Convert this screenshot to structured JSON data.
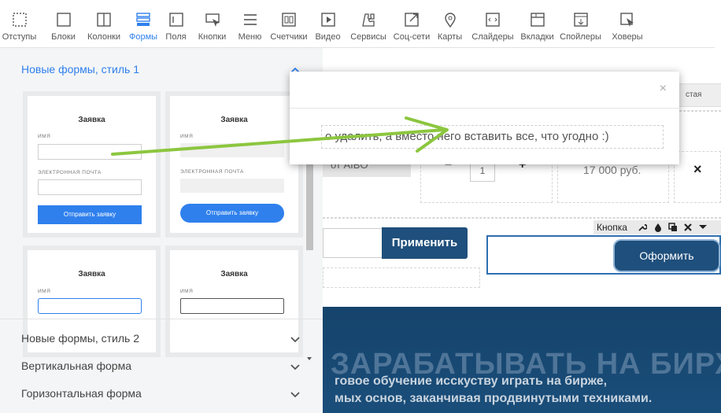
{
  "toolbar": {
    "items": [
      {
        "label": "Отступы",
        "icon": "padding-icon"
      },
      {
        "label": "Блоки",
        "icon": "blocks-icon"
      },
      {
        "label": "Колонки",
        "icon": "columns-icon"
      },
      {
        "label": "Формы",
        "icon": "forms-icon",
        "active": true
      },
      {
        "label": "Поля",
        "icon": "fields-icon"
      },
      {
        "label": "Кнопки",
        "icon": "buttons-icon"
      },
      {
        "label": "Меню",
        "icon": "menu-icon"
      },
      {
        "label": "Счетчики",
        "icon": "counters-icon"
      },
      {
        "label": "Видео",
        "icon": "video-icon"
      },
      {
        "label": "Сервисы",
        "icon": "services-icon"
      },
      {
        "label": "Соц-сети",
        "icon": "social-icon"
      },
      {
        "label": "Карты",
        "icon": "map-icon"
      },
      {
        "label": "Слайдеры",
        "icon": "sliders-icon"
      },
      {
        "label": "Вкладки",
        "icon": "tabs-icon"
      },
      {
        "label": "Спойлеры",
        "icon": "spoilers-icon"
      },
      {
        "label": "Ховеры",
        "icon": "hovers-icon"
      }
    ]
  },
  "panel": {
    "sections": [
      {
        "title": "Новые формы, стиль 1",
        "open": true
      },
      {
        "title": "Новые формы, стиль 2",
        "open": false
      },
      {
        "title": "Вертикальная форма",
        "open": false
      },
      {
        "title": "Горизонтальная форма",
        "open": false
      }
    ],
    "form_title": "Заявка",
    "name_label": "ИМЯ",
    "email_label": "ЭЛЕКТРОННАЯ ПОЧТА",
    "submit_label": "Отправить заявку"
  },
  "popup": {
    "close_glyph": "×",
    "text": "о удалить, а вместо него вставить все, что угодно :)"
  },
  "canvas": {
    "tab_fragment": "стая",
    "product_fragment": "от AIBO",
    "minus": "−",
    "qty": "1",
    "plus": "+",
    "price": "17 000 руб.",
    "remove_glyph": "×",
    "apply_button": "Применить",
    "button_toolbar_label": "Кнопка",
    "order_button": "Оформить"
  },
  "hero": {
    "title": "ЗАРАБАТЫВАТЬ НА БИРЖЕ",
    "line1": "говое обучение исскуству играть на бирже,",
    "line2": "мых основ, заканчивая продвинутыми техниками."
  }
}
